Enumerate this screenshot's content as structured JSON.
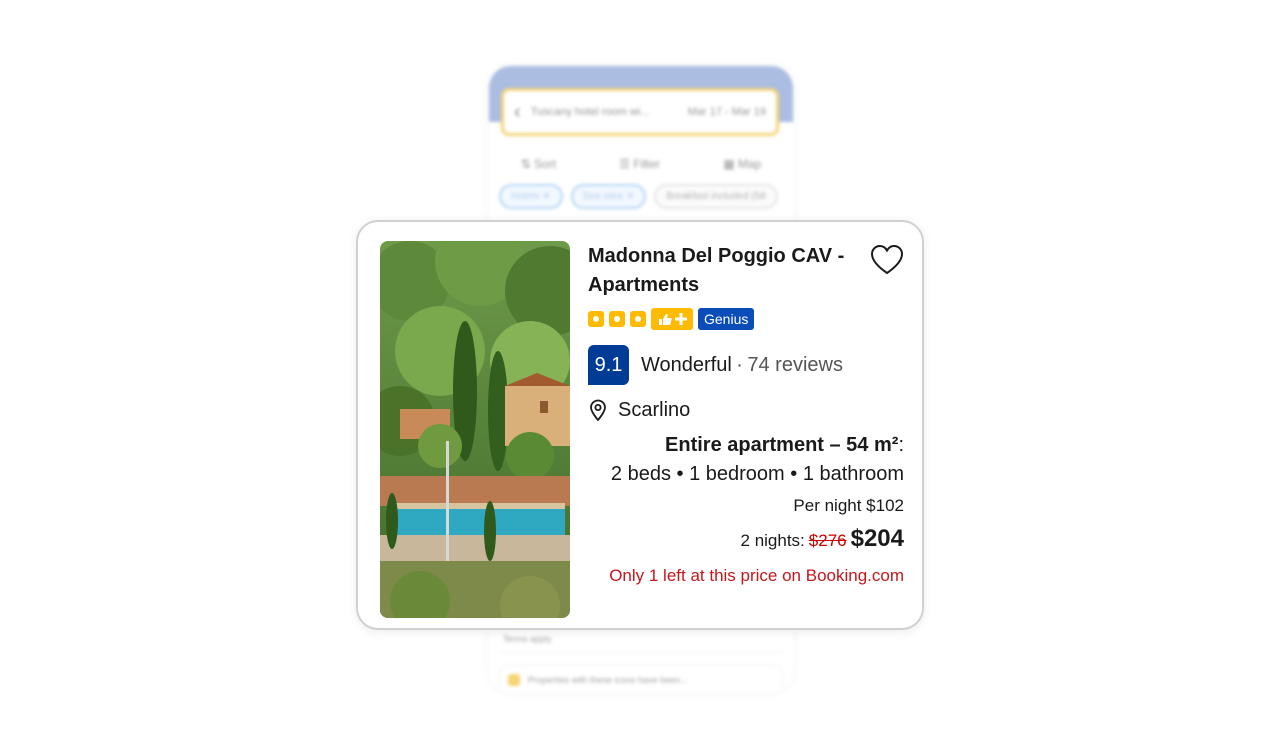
{
  "background_app": {
    "search_query": "Tuscany hotel room wi...",
    "search_dates": "Mar 17 - Mar 19",
    "toolbar": [
      "Sort",
      "Filter",
      "Map"
    ],
    "chips": [
      "Hotels",
      "Sea view",
      "Breakfast included (58"
    ],
    "terms_text": "Terms apply",
    "promo_text": "Properties with these icons have been..."
  },
  "card": {
    "title": "Madonna Del Poggio CAV - Apartments",
    "stars": 3,
    "genius_label": "Genius",
    "score": "9.1",
    "rating_word": "Wonderful",
    "separator": "·",
    "reviews": "74 reviews",
    "location": "Scarlino",
    "unit_type": "Entire apartment – 54 m²",
    "unit_type_suffix": ":",
    "beds": "2 beds • 1 bedroom • 1 bathroom",
    "per_night": "Per night $102",
    "nights_label": "2 nights:",
    "old_price": "$276",
    "new_price": "$204",
    "scarcity": "Only 1 left at this price on Booking.com"
  },
  "colors": {
    "brand_blue": "#003b95",
    "genius_blue": "#0b4db8",
    "star_yellow": "#febb02",
    "scarcity_red": "#c7161b"
  },
  "icons": [
    "back-arrow-icon",
    "sort-icon",
    "filter-icon",
    "map-icon",
    "close-icon",
    "star-icon",
    "thumbs-up-icon",
    "heart-icon",
    "location-pin-icon"
  ]
}
